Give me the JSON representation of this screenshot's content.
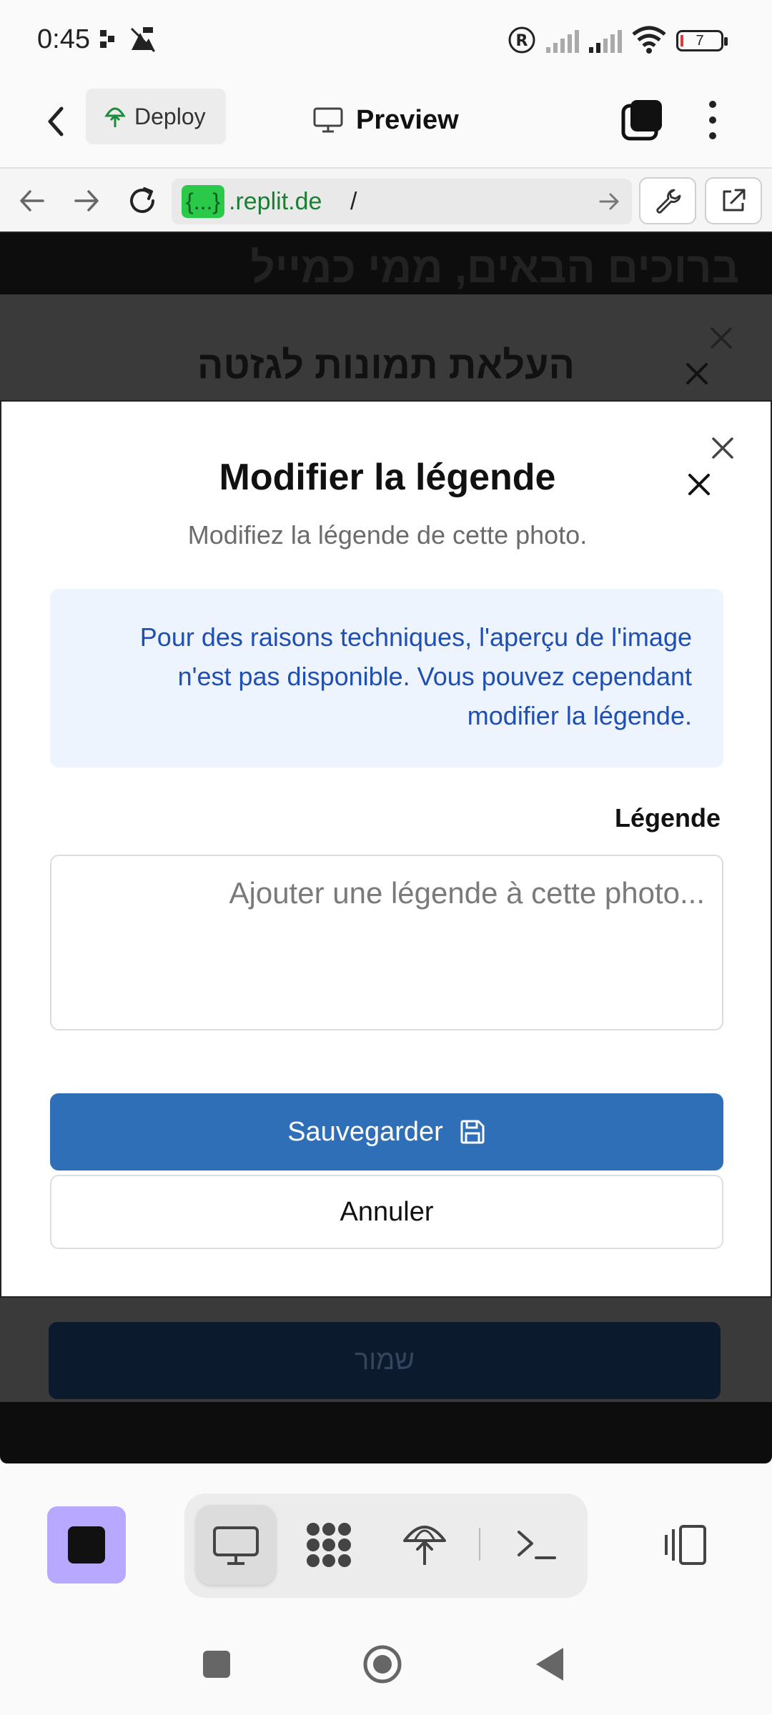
{
  "status_bar": {
    "time": "0:45",
    "battery": "7"
  },
  "topbar": {
    "deploy_label": "Deploy",
    "preview_label": "Preview"
  },
  "urlbar": {
    "tag": "{...}",
    "host": ".replit.de",
    "path": "/"
  },
  "background_page": {
    "heading": "ברוכים הבאים, ממי כמייל",
    "dialog_title": "העלאת תמונות לגזטה",
    "save_label": "שמור"
  },
  "modal": {
    "title": "Modifier la légende",
    "description": ".Modifiez la légende de cette photo",
    "info_line1": "Pour des raisons techniques, l'aperçu de l'image",
    "info_line2": "n'est pas disponible. Vous pouvez cependant",
    "info_line3": ".modifier la légende",
    "caption_label": "Légende",
    "caption_placeholder": "...Ajouter une légende à cette photo",
    "caption_value": "",
    "save_label": "Sauvegarder",
    "cancel_label": "Annuler"
  },
  "colors": {
    "primary_button": "#2f6fb7",
    "info_bg": "#eef4fd",
    "info_text": "#1f4fb3",
    "stop_button": "#b9a8ff",
    "url_tag": "#2bc94a"
  },
  "icons": {
    "toolbar": [
      "monitor-icon",
      "workspace-icon",
      "deploy-icon",
      "terminal-icon",
      "layout-icon"
    ],
    "navbar": [
      "recents-icon",
      "home-icon",
      "back-icon"
    ]
  }
}
